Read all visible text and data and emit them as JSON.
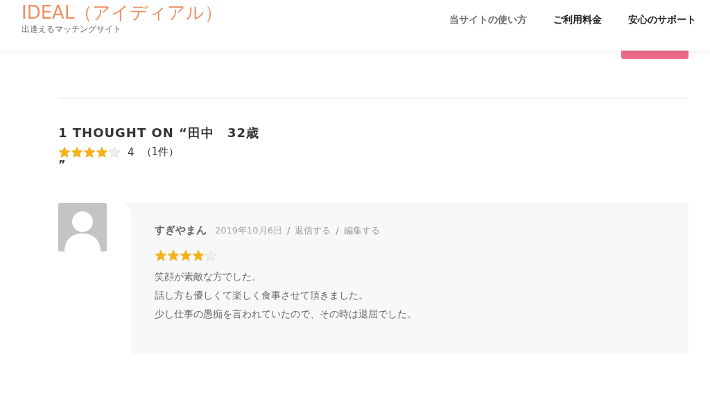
{
  "header": {
    "logo": "IDEAL（アイディアル）",
    "tagline": "出逢えるマッチングサイト",
    "nav": [
      {
        "label": "当サイトの使い方",
        "selected": true
      },
      {
        "label": "ご利用料金",
        "selected": false
      },
      {
        "label": "安心のサポート",
        "selected": false
      }
    ]
  },
  "comments_heading": {
    "text": "1 THOUGHT ON “田中　32歳",
    "rating": {
      "stars": 4,
      "value": "4",
      "count": "（1件）"
    },
    "closing": "”"
  },
  "comments": [
    {
      "author": "すぎやまん",
      "meta": [
        {
          "kind": "date",
          "text": "2019年10月6日"
        },
        {
          "kind": "separator",
          "text": "/"
        },
        {
          "kind": "link",
          "text": "返信する"
        },
        {
          "kind": "separator",
          "text": "/"
        },
        {
          "kind": "link",
          "text": "編集する"
        }
      ],
      "stars": 4,
      "lines": [
        "笑顔が素敵な方でした。",
        "話し方も優しくて楽しく食事させて頂きました。",
        "少し仕事の愚痴を言われていたので、その時は退屈でした。"
      ]
    }
  ]
}
